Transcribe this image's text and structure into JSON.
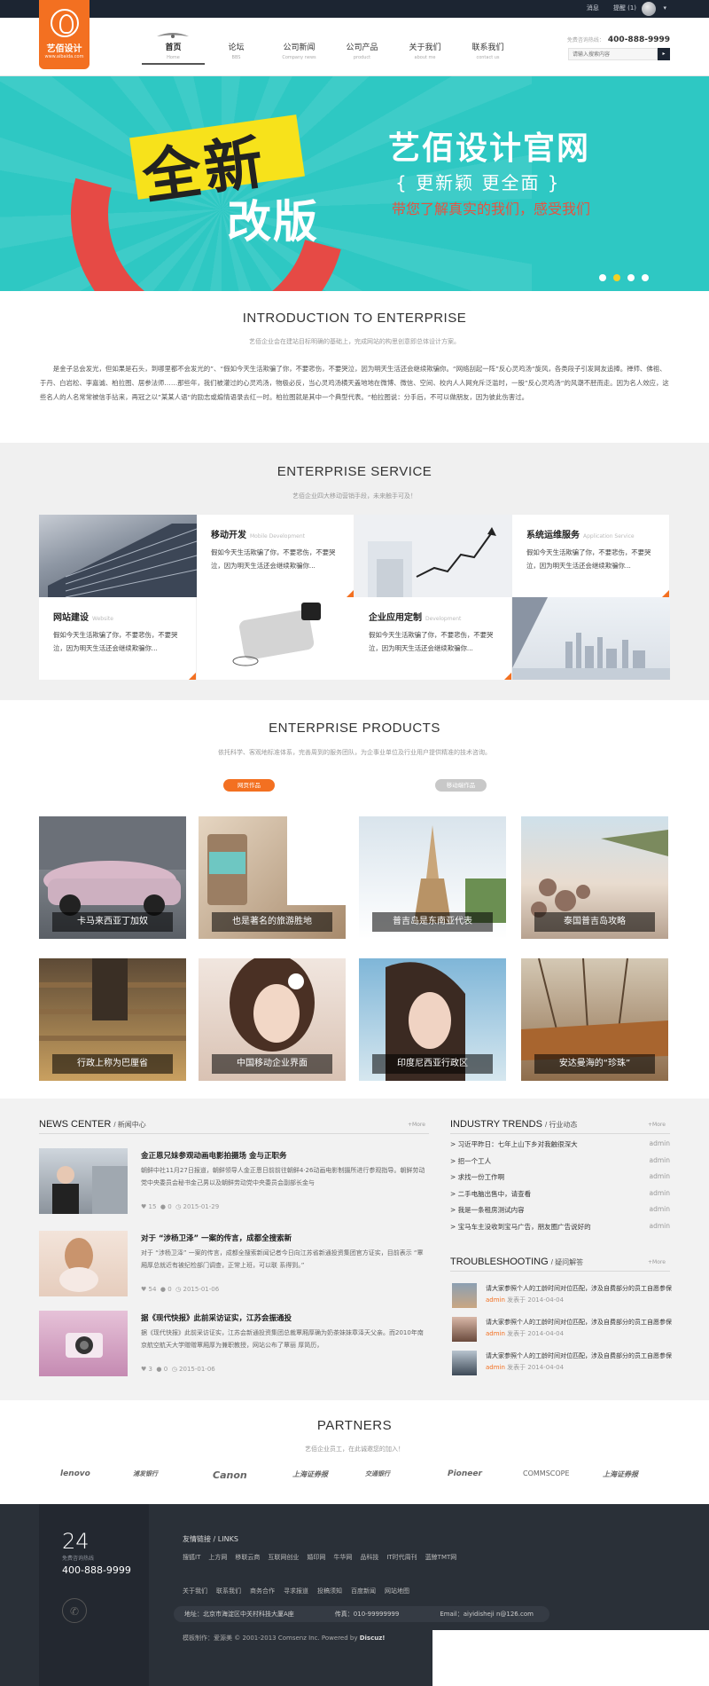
{
  "topbar": {
    "messages": "消息",
    "reminders": "提醒 (1)"
  },
  "logo": {
    "title": "艺佰设计",
    "url": "www.aibaida.com"
  },
  "nav": [
    {
      "zh": "首页",
      "en": "Home"
    },
    {
      "zh": "论坛",
      "en": "BBS"
    },
    {
      "zh": "公司新闻",
      "en": "Company news"
    },
    {
      "zh": "公司产品",
      "en": "product"
    },
    {
      "zh": "关于我们",
      "en": "about me"
    },
    {
      "zh": "联系我们",
      "en": "contact us"
    }
  ],
  "hotline": {
    "label": "免费咨询热线：",
    "number": "400-888-9999"
  },
  "search": {
    "placeholder": "请输入搜索内容",
    "button": "搜"
  },
  "banner": {
    "h1": "全新",
    "h2": "改版",
    "title": "艺佰设计官网",
    "subtitle": "{ 更新颖  更全面 }",
    "subtitle2": "带您了解真实的我们，感受我们"
  },
  "intro": {
    "title": "INTRODUCTION TO ENTERPRISE",
    "subtitle": "艺佰企业会在建站目标明确的基础上，完成网站的构思创意即总体设计方案。",
    "text": "是金子总会发光，但如果是石头，到哪里都不会发光的”、“假如今天生活欺骗了你，不要悲伤，不要哭泣，因为明天生活还会继续欺骗你。“网络刮起一阵”反心灵鸡汤“旋风，各类段子引发网友追捧。禅师、佛祖、于丹、白岩松、李嘉诚、柏拉图、居参法师……那些年，我们被灌过的心灵鸡汤，物极必反，当心灵鸡汤横天盖地地在微博、微信、空间、校内人人网充斥泛滥时，一股”反心灵鸡汤“的风潮不胫而走。因为名人效应，这些名人的人名常常被信手拈来，再冠之以”某某人语“的励志或煽情语录去红一时。柏拉图就是其中一个典型代表。“柏拉图说：分手后，不可以做朋友，因为彼此伤害过。"
  },
  "service": {
    "title": "ENTERPRISE SERVICE",
    "subtitle": "艺佰企业四大移动营销手段，未来触手可及！",
    "items": [
      {
        "title": "移动开发",
        "en": "Mobile Development",
        "text": "假如今天生活欺骗了你，不要悲伤，不要哭泣，因为明天生活还会继续欺骗你..."
      },
      {
        "title": "系统运维服务",
        "en": "Application Service",
        "text": "假如今天生活欺骗了你，不要悲伤，不要哭泣，因为明天生活还会继续欺骗你..."
      },
      {
        "title": "网站建设",
        "en": "Website",
        "text": "假如今天生活欺骗了你，不要悲伤，不要哭泣，因为明天生活还会继续欺骗你..."
      },
      {
        "title": "企业应用定制",
        "en": "Development",
        "text": "假如今天生活欺骗了你，不要悲伤，不要哭泣，因为明天生活还会继续欺骗你..."
      }
    ]
  },
  "products": {
    "title": "ENTERPRISE PRODUCTS",
    "subtitle": "依托科学、客观地标准体系，完善周到的服务团队，为企事业单位及行业用户提供精准的技术咨询。",
    "tabs": [
      "网页作品",
      "移动端作品"
    ],
    "items": [
      "卡马来西亚丁加奴",
      "也是著名的旅游胜地",
      "普吉岛是东南亚代表",
      "泰国普吉岛攻略",
      "行政上称为巴厘省",
      "中国移动企业界面",
      "印度尼西亚行政区",
      "安达曼海的“珍珠”"
    ]
  },
  "news": {
    "title": "NEWS CENTER",
    "title_zh": "新闻中心",
    "more": "+More",
    "items": [
      {
        "title": "金正恩兄妹参观动画电影拍摄场 金与正职务",
        "desc": "朝鲜中社11月27日报道，朝鲜领导人金正恩日前前往朝鲜4·26动画电影制摄所进行参观指导。朝鲜劳动党中央委员会秘书金己男以及朝鲜劳动党中央委员会副部长金与",
        "likes": "15",
        "comments": "0",
        "date": "2015-01-29"
      },
      {
        "title": "对于 “涉杨卫泽” 一案的传言，成都全搜索新",
        "desc": "对于 “涉杨卫泽” 一案的传言，成都全搜索新闻记者今日向江苏省新通投资集团官方证实，目前表示 “覃厢厚总就近有被纪检部门调查，正常上班，可以联 系得到。”",
        "likes": "54",
        "comments": "0",
        "date": "2015-01-06"
      },
      {
        "title": "据《现代快报》此前采访证实，江苏会振通投",
        "desc": "据《现代快报》此前采访证实，江苏会新通投资集团总裁覃厢厚确为奶茶妹妹章泽天父亲。而2010年南京航空航天大学赠赠覃厢厚为兼职教授，网站公布了覃丽 厚简历，",
        "likes": "3",
        "comments": "0",
        "date": "2015-01-06"
      }
    ]
  },
  "trends": {
    "title": "INDUSTRY TRENDS",
    "title_zh": "行业动态",
    "more": "+More",
    "items": [
      {
        "text": "> 习近平昨日：七年上山下乡对我触很深大",
        "author": "admin"
      },
      {
        "text": "> 招一个工人",
        "author": "admin"
      },
      {
        "text": "> 求找一份工作啊",
        "author": "admin"
      },
      {
        "text": "> 二手电脑出售中，请查看",
        "author": "admin"
      },
      {
        "text": "> 我是一条租房测试内容",
        "author": "admin"
      },
      {
        "text": "> 宝马车主没收到宝马广告，朋友圈广告说好的",
        "author": "admin"
      }
    ]
  },
  "troubleshooting": {
    "title": "TROUBLESHOOTING",
    "title_zh": "疑问解答",
    "more": "+More",
    "items": [
      {
        "q": "请大家参照个人的工龄时间对位匹配，涉及自费部分的员工自愿参保",
        "author": "admin",
        "date": "发表于 2014-04-04"
      },
      {
        "q": "请大家参照个人的工龄时间对位匹配，涉及自费部分的员工自愿参保",
        "author": "admin",
        "date": "发表于 2014-04-04"
      },
      {
        "q": "请大家参照个人的工龄时间对位匹配，涉及自费部分的员工自愿参保",
        "author": "admin",
        "date": "发表于 2014-04-04"
      }
    ]
  },
  "partners": {
    "title": "PARTNERS",
    "subtitle": "艺佰企业员工，在此诚邀您的加入！",
    "logos": [
      "lenovo",
      "浦发银行",
      "Canon",
      "上海证券报",
      "交通银行",
      "Pioneer",
      "COMMSCOPE",
      "上海证券报"
    ]
  },
  "footer": {
    "num": "24",
    "label": "免费咨询热线",
    "tel": "400-888-9999",
    "links_title": "友情链接 / LINKS",
    "links": [
      "搜狐IT",
      "上方网",
      "移联云商",
      "互联网创业",
      "婚印网",
      "牛华网",
      "品科技",
      "IT时代周刊",
      "蓝鲸TMT网"
    ],
    "nav": [
      "关于我们",
      "联系我们",
      "商务合作",
      "寻求报道",
      "投稿须知",
      "百度新闻",
      "网站地图"
    ],
    "address": "地址：北京市海淀区中关村科技大厦A座",
    "fax": "传真：010-99999999",
    "email": "Email：aiyidisheji n@126.com",
    "copyright": "模板制作：爱源美 © 2001-2013 Comsenz Inc. Powered by",
    "powered": "Discuz!"
  },
  "colors": {
    "accent": "#f37021",
    "banner": "#2ec8c3",
    "dark": "#1c2532",
    "footer": "#2a3038"
  }
}
